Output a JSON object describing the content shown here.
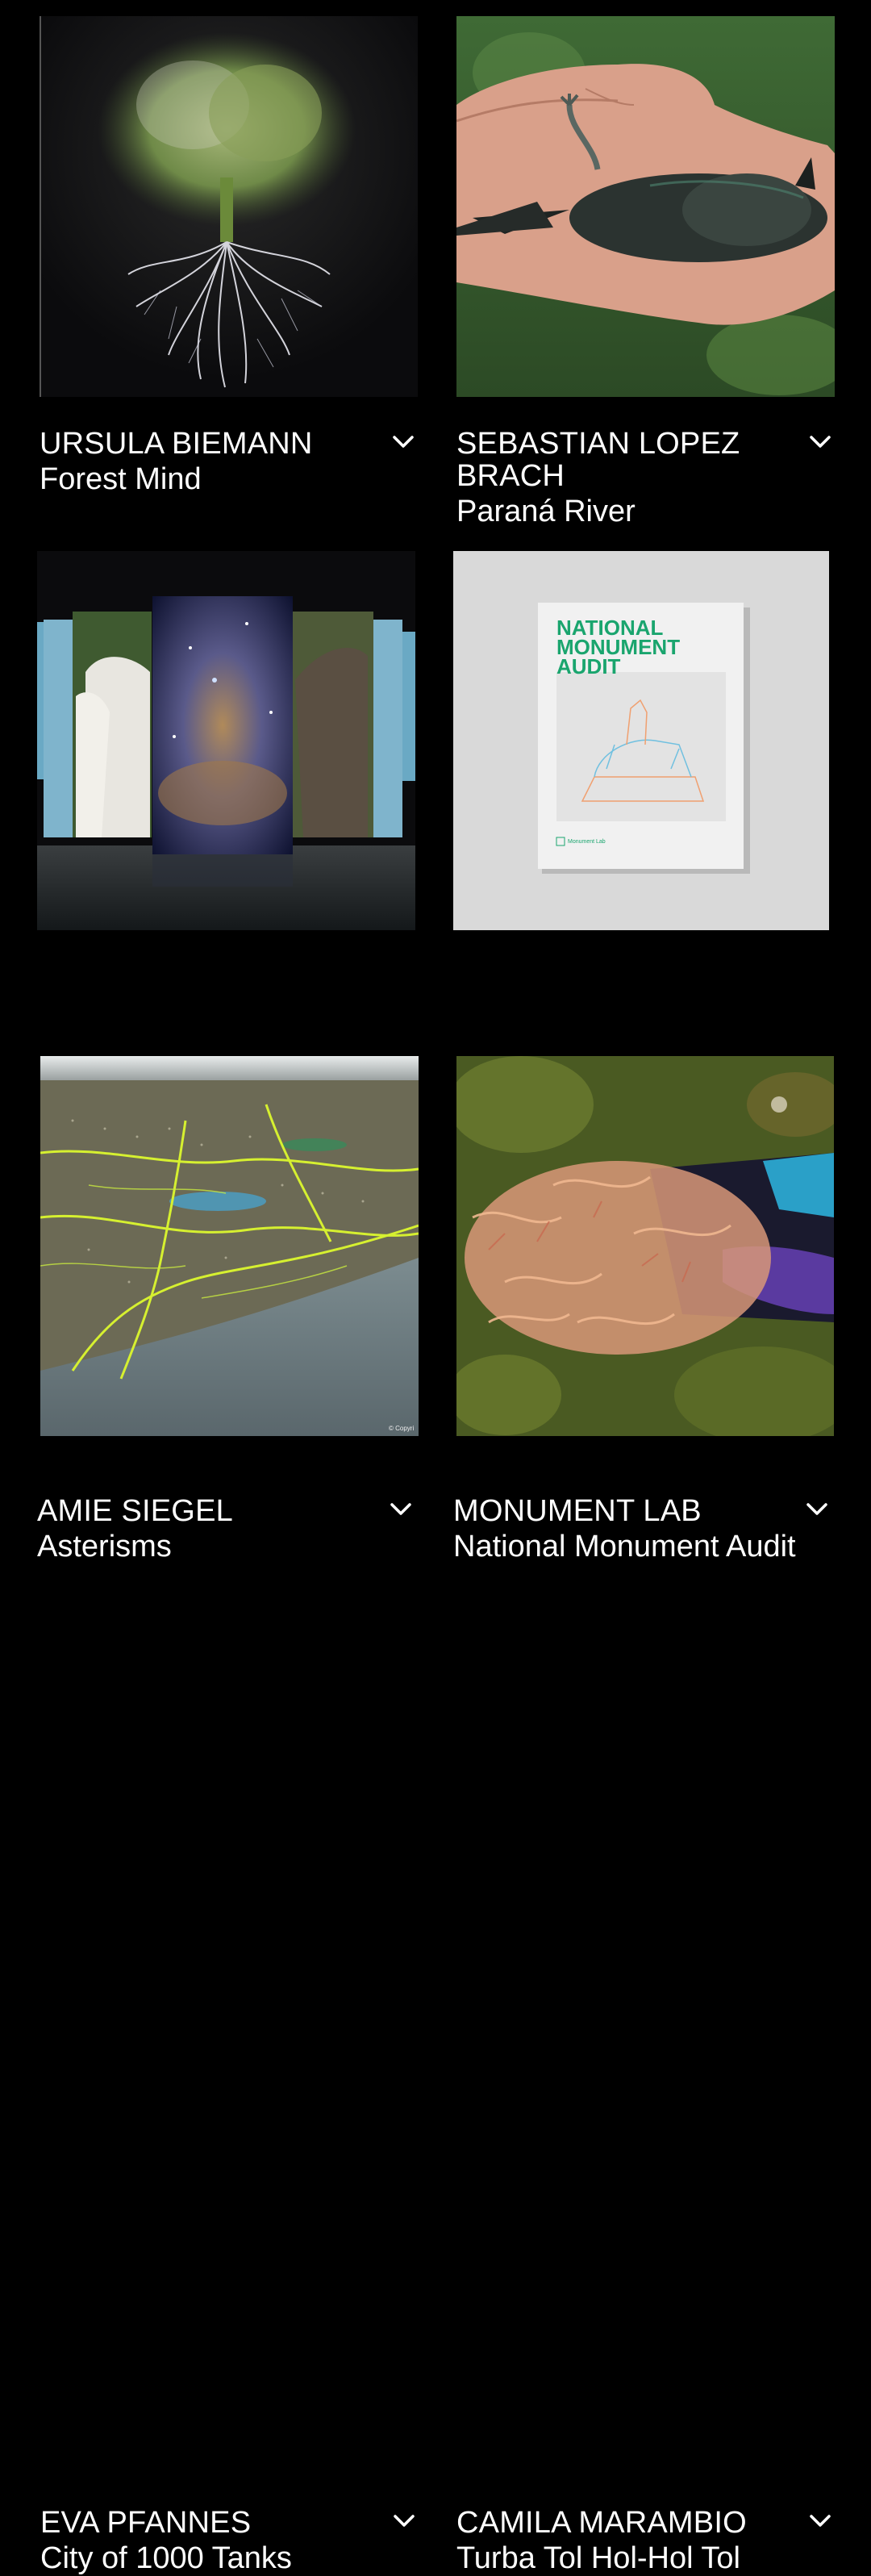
{
  "cards": [
    {
      "artist": "URSULA BIEMANN",
      "work": "Forest Mind",
      "image": "tree-with-roots-image",
      "icon": "chevron-down-icon"
    },
    {
      "artist": "SEBASTIAN LOPEZ BRACH",
      "work": "Paraná River",
      "image": "bird-in-hand-image",
      "icon": "chevron-down-icon"
    },
    {
      "artist": "AMIE SIEGEL",
      "work": "Asterisms",
      "image": "installation-screens-image",
      "icon": "chevron-down-icon"
    },
    {
      "artist": "MONUMENT LAB",
      "work": "National Monument Audit",
      "image": "report-cover-image",
      "icon": "chevron-down-icon",
      "cover_title": [
        "NATIONAL",
        "MONUMENT",
        "AUDIT"
      ],
      "cover_publisher": "Monument Lab"
    },
    {
      "artist": "EVA PFANNES",
      "work": "City of 1000 Tanks",
      "image": "aerial-map-image",
      "icon": "chevron-down-icon",
      "image_credit": "© Copyri"
    },
    {
      "artist": "CAMILA MARAMBIO",
      "work": "Turba Tol Hol-Hol Tol",
      "image": "peat-moss-image",
      "icon": "chevron-down-icon"
    }
  ],
  "colors": {
    "background": "#000000",
    "text": "#ffffff",
    "cover_green": "#1aa56e"
  }
}
